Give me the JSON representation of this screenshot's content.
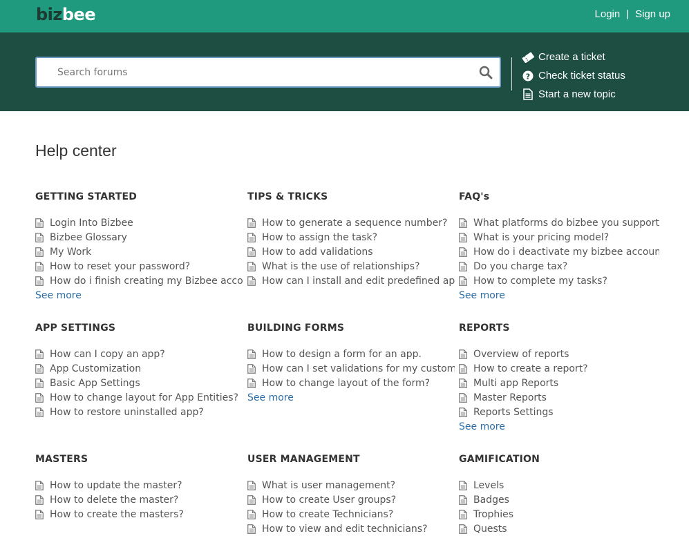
{
  "header": {
    "logo_part1": "biz",
    "logo_part2": "bee",
    "login": "Login",
    "separator": "|",
    "signup": "Sign up"
  },
  "search": {
    "placeholder": "Search forums",
    "icon": "search-icon"
  },
  "actions": [
    {
      "label": "Create a ticket",
      "icon": "ticket-icon"
    },
    {
      "label": "Check ticket status",
      "icon": "question-circle-icon"
    },
    {
      "label": "Start a new topic",
      "icon": "document-icon"
    }
  ],
  "page_title": "Help center",
  "sections": [
    {
      "title": "GETTING STARTED",
      "items": [
        "Login Into Bizbee",
        "Bizbee Glossary",
        "My Work",
        "How to reset your password?",
        "How do i finish creating my Bizbee account"
      ],
      "see_more": "See more"
    },
    {
      "title": "TIPS & TRICKS",
      "items": [
        "How to generate a sequence number?",
        "How to assign the task?",
        "How to add validations",
        "What is the use of relationships?",
        "How can I install and edit predefined app's?"
      ],
      "see_more": ""
    },
    {
      "title": "FAQ's",
      "items": [
        "What platforms do bizbee you support?",
        "What is your pricing model?",
        "How do i deactivate my bizbee account ?",
        "Do you charge tax?",
        "How to complete my tasks?"
      ],
      "see_more": "See more"
    },
    {
      "title": "APP SETTINGS",
      "items": [
        "How can I copy an app?",
        "App Customization",
        "Basic App Settings",
        "How to change layout for App Entities?",
        "How to restore uninstalled app?"
      ],
      "see_more": ""
    },
    {
      "title": "BUILDING FORMS",
      "items": [
        "How to design a form for an app.",
        "How can I set validations for my custom fields?",
        "How to change layout of the form?"
      ],
      "see_more": "See more"
    },
    {
      "title": "REPORTS",
      "items": [
        "Overview of reports",
        "How to create a report?",
        "Multi app Reports",
        "Master Reports",
        "Reports Settings"
      ],
      "see_more": "See more"
    },
    {
      "title": "MASTERS",
      "items": [
        "How to update the master?",
        "How to delete the master?",
        "How to create the masters?"
      ],
      "see_more": ""
    },
    {
      "title": "USER MANAGEMENT",
      "items": [
        "What is user management?",
        "How to create User groups?",
        "How to create Technicians?",
        "How to view and edit technicians?"
      ],
      "see_more": ""
    },
    {
      "title": "GAMIFICATION",
      "items": [
        "Levels",
        "Badges",
        "Trophies",
        "Quests"
      ],
      "see_more": ""
    }
  ]
}
